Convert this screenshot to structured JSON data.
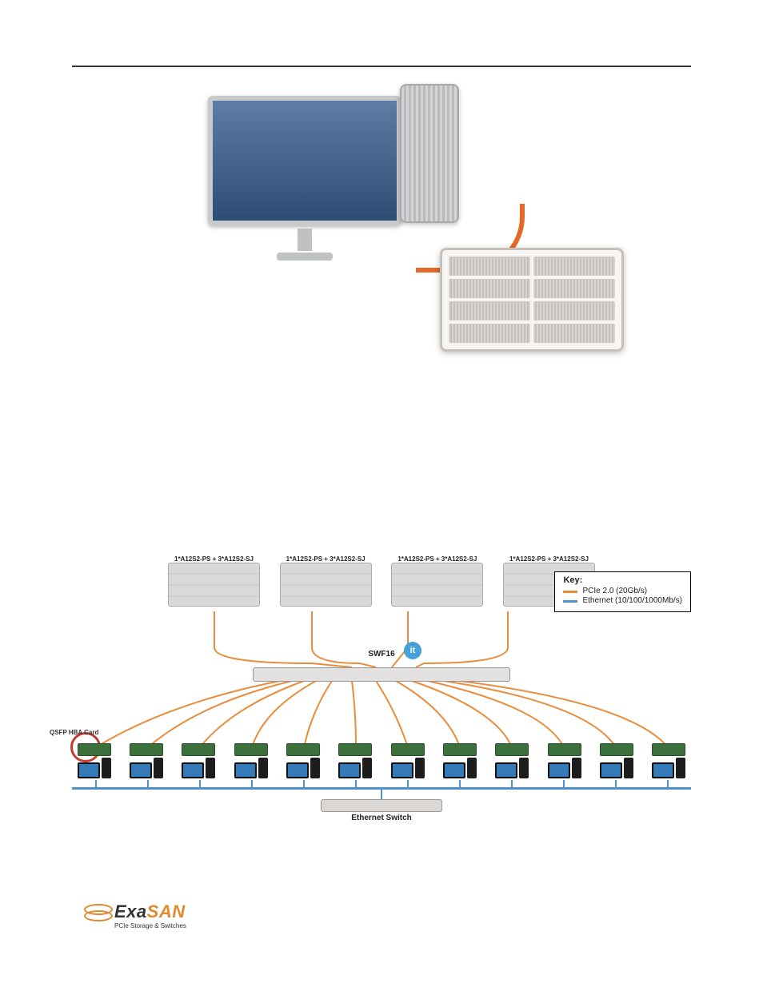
{
  "diagram1": {
    "components": [
      "monitor",
      "tower-workstation",
      "pcie-cable",
      "storage-array-8bay"
    ]
  },
  "diagram2": {
    "stack_label": "1*A12S2-PS + 3*A12S2-SJ",
    "switch_label": "SWF16",
    "switch_badge": "it",
    "key": {
      "title": "Key:",
      "pcie": "PCIe 2.0 (20Gb/s)",
      "eth": "Ethernet (10/100/1000Mb/s)"
    },
    "qsfp_label": "QSFP HBA Card",
    "ethernet_switch_label": "Ethernet Switch",
    "client_count": 12,
    "stack_count": 4
  },
  "logo": {
    "part1": "Exa",
    "part2": "SAN",
    "sub": "PCIe Storage & Switches"
  }
}
